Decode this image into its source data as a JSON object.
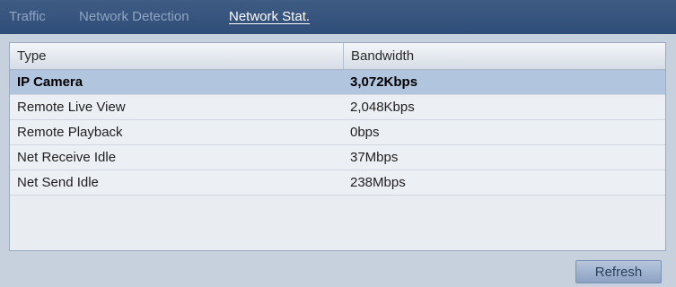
{
  "tabs": [
    {
      "label": "Traffic",
      "active": false
    },
    {
      "label": "Network Detection",
      "active": false
    },
    {
      "label": "Network Stat.",
      "active": true
    }
  ],
  "table": {
    "headers": {
      "type": "Type",
      "bandwidth": "Bandwidth"
    },
    "rows": [
      {
        "type": "IP Camera",
        "bandwidth": "3,072Kbps",
        "selected": true
      },
      {
        "type": "Remote Live View",
        "bandwidth": "2,048Kbps",
        "selected": false
      },
      {
        "type": "Remote Playback",
        "bandwidth": "0bps",
        "selected": false
      },
      {
        "type": "Net Receive Idle",
        "bandwidth": "37Mbps",
        "selected": false
      },
      {
        "type": "Net Send Idle",
        "bandwidth": "238Mbps",
        "selected": false
      }
    ]
  },
  "buttons": {
    "refresh": "Refresh"
  },
  "colors": {
    "tab_bar": "#34517b",
    "selected_row": "#b1c5df",
    "background": "#c7d1de"
  }
}
